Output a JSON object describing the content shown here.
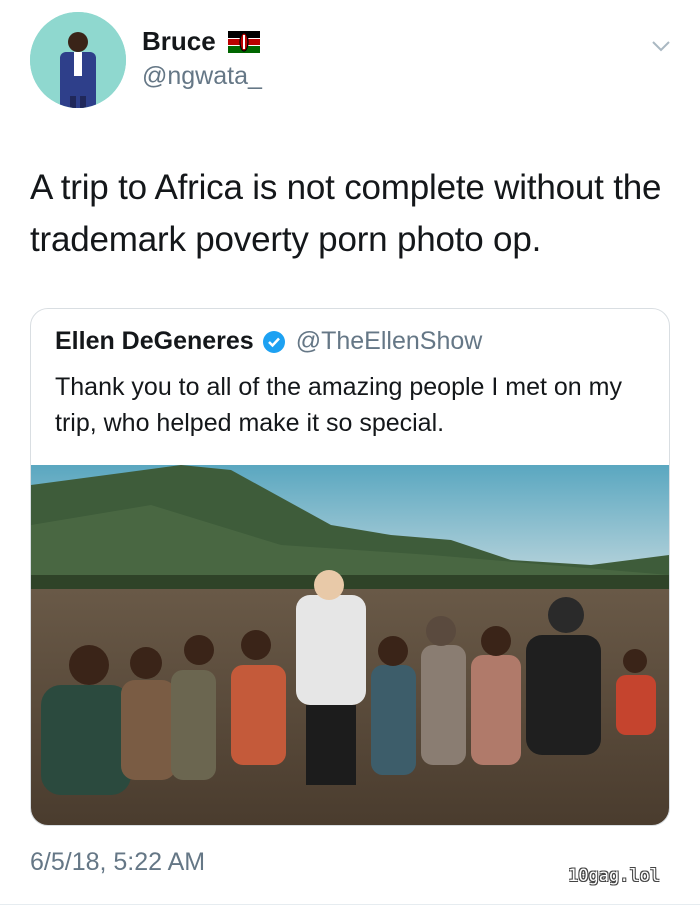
{
  "tweet": {
    "author": {
      "display_name": "Bruce",
      "handle": "@ngwata_",
      "flag_icon": "kenya-flag-icon"
    },
    "text": "A trip to Africa is not complete without the trademark poverty porn photo op.",
    "timestamp": "6/5/18, 5:22 AM"
  },
  "quoted_tweet": {
    "display_name": "Ellen DeGeneres",
    "handle": "@TheEllenShow",
    "verified_icon": "verified-badge-icon",
    "text": "Thank you to all of the amazing people I met on my trip, who helped make it so special."
  },
  "watermark": "10gag.lol",
  "colors": {
    "text": "#14171a",
    "secondary": "#657786",
    "verified": "#1da1f2",
    "border": "#d9dee2"
  }
}
